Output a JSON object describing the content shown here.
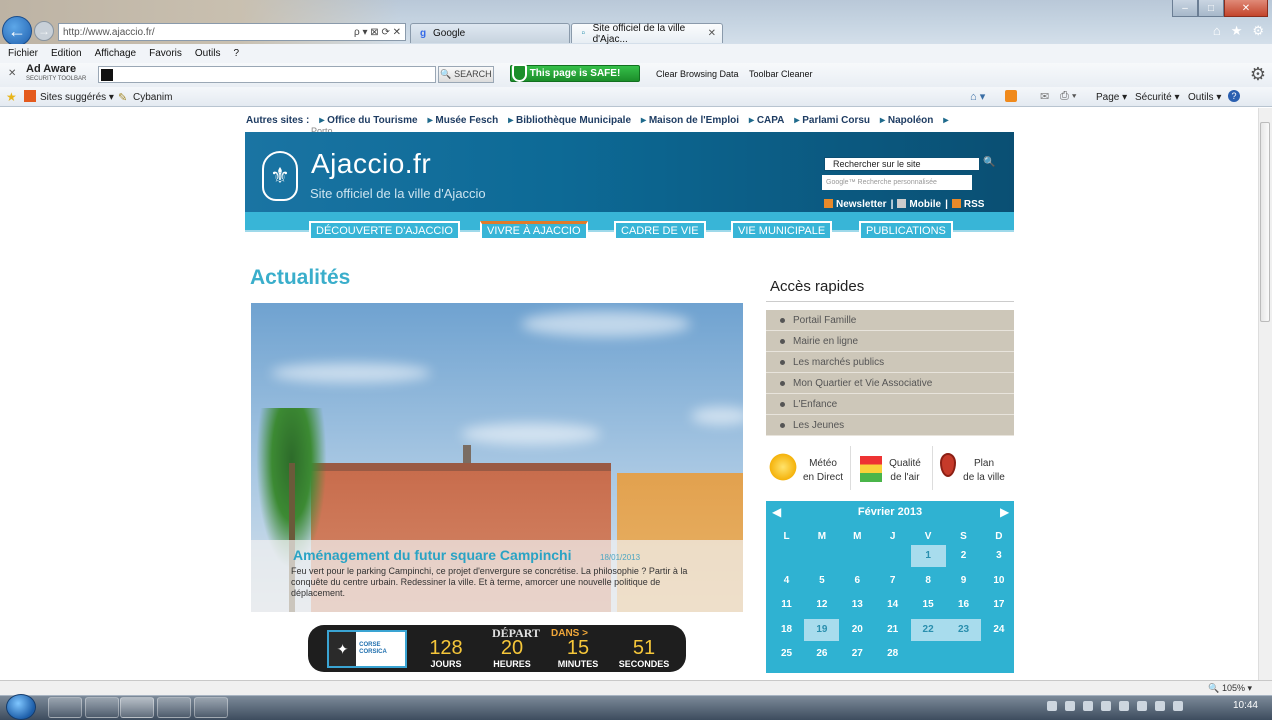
{
  "browser": {
    "address_url": "http://www.ajaccio.fr/",
    "address_controls": "ρ ▾ ⊠ ⟳ ✕",
    "tabs": [
      {
        "label": "Google",
        "close": "✕"
      },
      {
        "label": "Site officiel de la ville d'Ajac...",
        "close": "✕"
      }
    ],
    "window_controls": [
      "–",
      "□",
      "✕"
    ],
    "right_icons": [
      "⌂",
      "★",
      "⚙"
    ],
    "menu": [
      "Fichier",
      "Edition",
      "Affichage",
      "Favoris",
      "Outils",
      "?"
    ],
    "toolbar": {
      "close": "✕",
      "adaware_name": "Ad Aware",
      "adaware_sub": "SECURITY TOOLBAR",
      "search_btn": "🔍 SEARCH",
      "safe_badge": "This page is SAFE!",
      "clear_browsing": "Clear Browsing Data",
      "toolbar_cleaner": "Toolbar Cleaner"
    },
    "favorites": {
      "suggested": "Sites suggérés ▾",
      "cybanim": "Cybanim",
      "page": "Page ▾",
      "securite": "Sécurité ▾",
      "outils": "Outils ▾"
    },
    "zoom": "105%",
    "clock": "10:44"
  },
  "site": {
    "other_sites_label": "Autres sites :",
    "other_sites": [
      "Office du Tourisme",
      "Musée Fesch",
      "Bibliothèque Municipale",
      "Maison de l'Emploi",
      "CAPA",
      "Parlami Corsu",
      "Napoléon",
      ""
    ],
    "porto": "Porto",
    "title": "Ajaccio.fr",
    "subtitle": "Site officiel de la ville d'Ajaccio",
    "search_value": "Rechercher sur le site",
    "google_search_placeholder": "Google™ Recherche personnalisée",
    "header_links": [
      "Newsletter",
      "Mobile",
      "RSS"
    ],
    "nav": [
      "DÉCOUVERTE D'AJACCIO",
      "VIVRE À AJACCIO",
      "CADRE DE VIE",
      "VIE MUNICIPALE",
      "PUBLICATIONS"
    ],
    "nav_active": 1,
    "news_heading": "Actualités",
    "hero": {
      "title": "Aménagement du futur square Campinchi",
      "date": "18/01/2013",
      "text": "Feu vert pour le parking Campinchi, ce projet d'envergure se concrétise. La philosophie ? Partir à la conquête du centre urbain. Redessiner la ville. Et à terme, amorcer une nouvelle politique de déplacement."
    },
    "countdown": {
      "depart": "DÉPART",
      "dans": "DANS >",
      "brand": "CORSE CORSICA",
      "items": [
        {
          "value": "128",
          "unit": "JOURS"
        },
        {
          "value": "20",
          "unit": "HEURES"
        },
        {
          "value": "15",
          "unit": "MINUTES"
        },
        {
          "value": "51",
          "unit": "SECONDES"
        }
      ]
    },
    "quick_access_title": "Accès rapides",
    "quick_links": [
      "Portail Famille",
      "Mairie en ligne",
      "Les marchés publics",
      "Mon Quartier et Vie Associative",
      "L'Enfance",
      "Les Jeunes"
    ],
    "widgets": [
      {
        "line1": "Météo",
        "line2": "en Direct"
      },
      {
        "line1": "Qualité",
        "line2": "de l'air"
      },
      {
        "line1": "Plan",
        "line2": "de la ville"
      }
    ],
    "calendar": {
      "month": "Février 2013",
      "prev": "◀",
      "next": "▶",
      "dow": [
        "L",
        "M",
        "M",
        "J",
        "V",
        "S",
        "D"
      ],
      "weeks": [
        [
          "",
          "",
          "",
          "",
          "1",
          "2",
          "3"
        ],
        [
          "4",
          "5",
          "6",
          "7",
          "8",
          "9",
          "10"
        ],
        [
          "11",
          "12",
          "13",
          "14",
          "15",
          "16",
          "17"
        ],
        [
          "18",
          "19",
          "20",
          "21",
          "22",
          "23",
          "24"
        ],
        [
          "25",
          "26",
          "27",
          "28",
          "",
          "",
          ""
        ]
      ],
      "highlighted": [
        "1",
        "19",
        "22",
        "23"
      ]
    }
  }
}
